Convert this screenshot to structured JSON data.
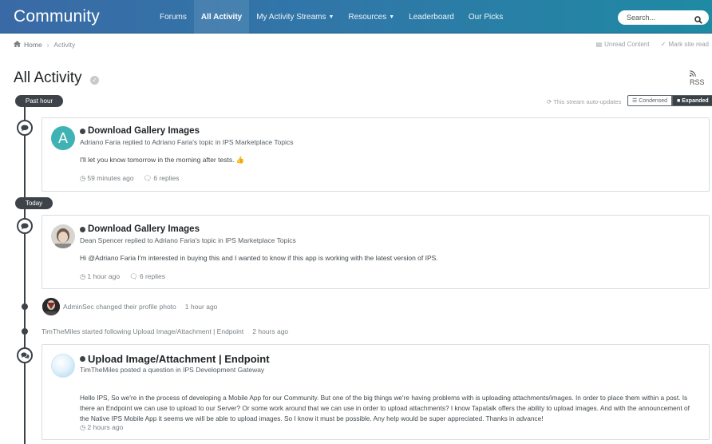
{
  "header": {
    "logo": "Community",
    "nav": [
      {
        "label": "Forums",
        "dropdown": false,
        "active": false
      },
      {
        "label": "All Activity",
        "dropdown": false,
        "active": true
      },
      {
        "label": "My Activity Streams",
        "dropdown": true,
        "active": false
      },
      {
        "label": "Resources",
        "dropdown": true,
        "active": false
      },
      {
        "label": "Leaderboard",
        "dropdown": false,
        "active": false
      },
      {
        "label": "Our Picks",
        "dropdown": false,
        "active": false
      }
    ],
    "search_placeholder": "Search...",
    "search_icon": "search-icon"
  },
  "breadcrumb": {
    "home": "Home",
    "current": "Activity"
  },
  "top_actions": {
    "unread": "Unread Content",
    "mark_read": "Mark site read"
  },
  "page": {
    "title": "All Activity",
    "rss": "RSS",
    "auto_update": "This stream auto-updates"
  },
  "view_toggle": {
    "condensed": "Condensed",
    "expanded": "Expanded",
    "selected": "Expanded"
  },
  "sections": {
    "past_hour": "Past hour",
    "today": "Today"
  },
  "items": [
    {
      "title": "Download Gallery Images",
      "subtitle": "Adriano Faria replied to Adriano Faria's topic in IPS Marketplace Topics",
      "avatar_letter": "A",
      "avatar_color": "#3fb3b3",
      "body": "I'll let you know tomorrow in the morning after tests. 👍",
      "time": "59 minutes ago",
      "replies": "6 replies"
    },
    {
      "title": "Download Gallery Images",
      "subtitle": "Dean Spencer replied to Adriano Faria's topic in IPS Marketplace Topics",
      "body": "Hi @Adriano Faria I'm interested in buying this and I wanted to know if this app is working with the latest version of IPS.",
      "time": "1 hour ago",
      "replies": "6 replies"
    },
    {
      "title": "Upload Image/Attachment | Endpoint",
      "subtitle": "TimTheMiles posted a question in IPS Development Gateway",
      "body": "Hello IPS, So we're in the process of developing a Mobile App for our Community. But one of the big things we're having problems with is uploading attachments/images. In order to place them within a post. Is there an Endpoint we can use to upload to our Server? Or some work around that we can use in order to upload attachments? I know Tapatalk offers the ability to upload images. And with the announcement of the Native IPS Mobile App it seems we will be able to upload images. So I know it must be possible. Any help would be super appreciated. Thanks in advance!",
      "time": "2 hours ago"
    }
  ],
  "activities": [
    {
      "text": "AdminSec changed their profile photo",
      "time": "1 hour ago"
    },
    {
      "text": "TimTheMiles started following Upload Image/Attachment | Endpoint",
      "time": "2 hours ago"
    }
  ]
}
